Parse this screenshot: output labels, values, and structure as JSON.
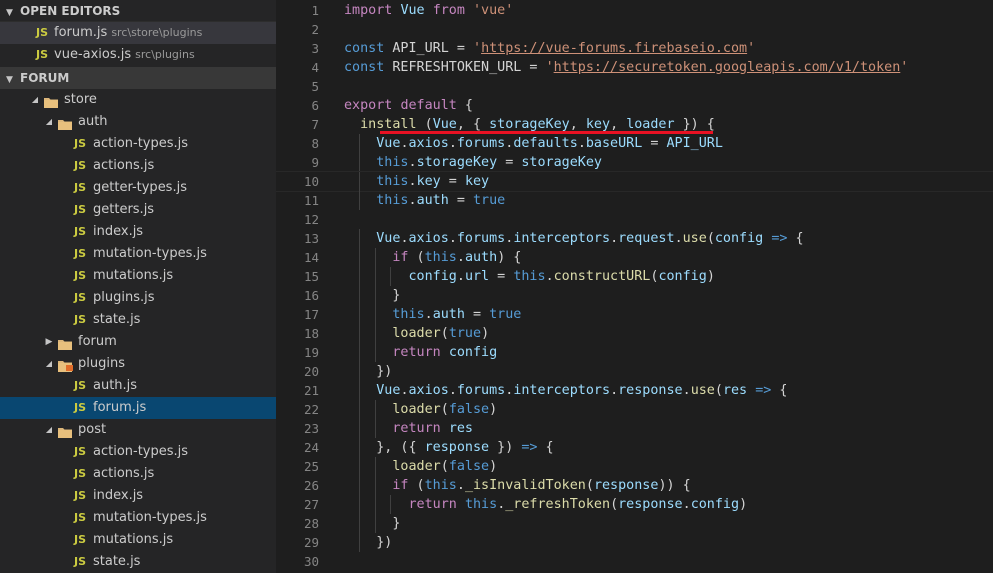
{
  "sidebar": {
    "open_editors_title": "OPEN EDITORS",
    "open_editors": [
      {
        "icon": "JS",
        "name": "forum.js",
        "path": "src\\store\\plugins",
        "active": true
      },
      {
        "icon": "JS",
        "name": "vue-axios.js",
        "path": "src\\plugins",
        "active": false
      }
    ],
    "project_title": "FORUM",
    "tree": [
      {
        "type": "folder",
        "name": "store",
        "depth": 0,
        "expanded": true
      },
      {
        "type": "folder",
        "name": "auth",
        "depth": 1,
        "expanded": true
      },
      {
        "type": "file",
        "name": "action-types.js",
        "depth": 2
      },
      {
        "type": "file",
        "name": "actions.js",
        "depth": 2
      },
      {
        "type": "file",
        "name": "getter-types.js",
        "depth": 2
      },
      {
        "type": "file",
        "name": "getters.js",
        "depth": 2
      },
      {
        "type": "file",
        "name": "index.js",
        "depth": 2
      },
      {
        "type": "file",
        "name": "mutation-types.js",
        "depth": 2
      },
      {
        "type": "file",
        "name": "mutations.js",
        "depth": 2
      },
      {
        "type": "file",
        "name": "plugins.js",
        "depth": 2
      },
      {
        "type": "file",
        "name": "state.js",
        "depth": 2
      },
      {
        "type": "folder",
        "name": "forum",
        "depth": 1,
        "expanded": false
      },
      {
        "type": "folder",
        "name": "plugins",
        "depth": 1,
        "expanded": true,
        "special": true
      },
      {
        "type": "file",
        "name": "auth.js",
        "depth": 2
      },
      {
        "type": "file",
        "name": "forum.js",
        "depth": 2,
        "selected": true
      },
      {
        "type": "folder",
        "name": "post",
        "depth": 1,
        "expanded": true
      },
      {
        "type": "file",
        "name": "action-types.js",
        "depth": 2
      },
      {
        "type": "file",
        "name": "actions.js",
        "depth": 2
      },
      {
        "type": "file",
        "name": "index.js",
        "depth": 2
      },
      {
        "type": "file",
        "name": "mutation-types.js",
        "depth": 2
      },
      {
        "type": "file",
        "name": "mutations.js",
        "depth": 2
      },
      {
        "type": "file",
        "name": "state.js",
        "depth": 2
      }
    ]
  },
  "editor": {
    "lines": [
      [
        [
          "kw2",
          "import"
        ],
        [
          "op",
          " "
        ],
        [
          "var",
          "Vue"
        ],
        [
          "op",
          " "
        ],
        [
          "kw2",
          "from"
        ],
        [
          "op",
          " "
        ],
        [
          "str",
          "'vue'"
        ]
      ],
      [],
      [
        [
          "kw",
          "const"
        ],
        [
          "op",
          " API_URL = "
        ],
        [
          "str",
          "'"
        ],
        [
          "str url",
          "https://vue-forums.firebaseio.com"
        ],
        [
          "str",
          "'"
        ]
      ],
      [
        [
          "kw",
          "const"
        ],
        [
          "op",
          " REFRESHTOKEN_URL = "
        ],
        [
          "str",
          "'"
        ],
        [
          "str url",
          "https://securetoken.googleapis.com/v1/token"
        ],
        [
          "str",
          "'"
        ]
      ],
      [],
      [
        [
          "kw2",
          "export"
        ],
        [
          "op",
          " "
        ],
        [
          "kw2",
          "default"
        ],
        [
          "op",
          " {"
        ]
      ],
      [
        [
          "op",
          "  "
        ],
        [
          "fn",
          "install"
        ],
        [
          "op",
          " ("
        ],
        [
          "var",
          "Vue"
        ],
        [
          "op",
          ", { "
        ],
        [
          "var",
          "storageKey"
        ],
        [
          "op",
          ", "
        ],
        [
          "var",
          "key"
        ],
        [
          "op",
          ", "
        ],
        [
          "var",
          "loader"
        ],
        [
          "op",
          " }) {"
        ]
      ],
      [
        [
          "op",
          "    "
        ],
        [
          "var",
          "Vue"
        ],
        [
          "op",
          "."
        ],
        [
          "var",
          "axios"
        ],
        [
          "op",
          "."
        ],
        [
          "var",
          "forums"
        ],
        [
          "op",
          "."
        ],
        [
          "var",
          "defaults"
        ],
        [
          "op",
          "."
        ],
        [
          "var",
          "baseURL"
        ],
        [
          "op",
          " = "
        ],
        [
          "var",
          "API_URL"
        ]
      ],
      [
        [
          "op",
          "    "
        ],
        [
          "kw",
          "this"
        ],
        [
          "op",
          "."
        ],
        [
          "var",
          "storageKey"
        ],
        [
          "op",
          " = "
        ],
        [
          "var",
          "storageKey"
        ]
      ],
      [
        [
          "op",
          "    "
        ],
        [
          "kw",
          "this"
        ],
        [
          "op",
          "."
        ],
        [
          "var",
          "key"
        ],
        [
          "op",
          " = "
        ],
        [
          "var",
          "key"
        ]
      ],
      [
        [
          "op",
          "    "
        ],
        [
          "kw",
          "this"
        ],
        [
          "op",
          "."
        ],
        [
          "var",
          "auth"
        ],
        [
          "op",
          " = "
        ],
        [
          "kw",
          "true"
        ]
      ],
      [],
      [
        [
          "op",
          "    "
        ],
        [
          "var",
          "Vue"
        ],
        [
          "op",
          "."
        ],
        [
          "var",
          "axios"
        ],
        [
          "op",
          "."
        ],
        [
          "var",
          "forums"
        ],
        [
          "op",
          "."
        ],
        [
          "var",
          "interceptors"
        ],
        [
          "op",
          "."
        ],
        [
          "var",
          "request"
        ],
        [
          "op",
          "."
        ],
        [
          "fn",
          "use"
        ],
        [
          "op",
          "("
        ],
        [
          "var",
          "config"
        ],
        [
          "op",
          " "
        ],
        [
          "kw",
          "=>"
        ],
        [
          "op",
          " {"
        ]
      ],
      [
        [
          "op",
          "      "
        ],
        [
          "kw2",
          "if"
        ],
        [
          "op",
          " ("
        ],
        [
          "kw",
          "this"
        ],
        [
          "op",
          "."
        ],
        [
          "var",
          "auth"
        ],
        [
          "op",
          ") {"
        ]
      ],
      [
        [
          "op",
          "        "
        ],
        [
          "var",
          "config"
        ],
        [
          "op",
          "."
        ],
        [
          "var",
          "url"
        ],
        [
          "op",
          " = "
        ],
        [
          "kw",
          "this"
        ],
        [
          "op",
          "."
        ],
        [
          "fn",
          "constructURL"
        ],
        [
          "op",
          "("
        ],
        [
          "var",
          "config"
        ],
        [
          "op",
          ")"
        ]
      ],
      [
        [
          "op",
          "      }"
        ]
      ],
      [
        [
          "op",
          "      "
        ],
        [
          "kw",
          "this"
        ],
        [
          "op",
          "."
        ],
        [
          "var",
          "auth"
        ],
        [
          "op",
          " = "
        ],
        [
          "kw",
          "true"
        ]
      ],
      [
        [
          "op",
          "      "
        ],
        [
          "fn",
          "loader"
        ],
        [
          "op",
          "("
        ],
        [
          "kw",
          "true"
        ],
        [
          "op",
          ")"
        ]
      ],
      [
        [
          "op",
          "      "
        ],
        [
          "kw2",
          "return"
        ],
        [
          "op",
          " "
        ],
        [
          "var",
          "config"
        ]
      ],
      [
        [
          "op",
          "    })"
        ]
      ],
      [
        [
          "op",
          "    "
        ],
        [
          "var",
          "Vue"
        ],
        [
          "op",
          "."
        ],
        [
          "var",
          "axios"
        ],
        [
          "op",
          "."
        ],
        [
          "var",
          "forums"
        ],
        [
          "op",
          "."
        ],
        [
          "var",
          "interceptors"
        ],
        [
          "op",
          "."
        ],
        [
          "var",
          "response"
        ],
        [
          "op",
          "."
        ],
        [
          "fn",
          "use"
        ],
        [
          "op",
          "("
        ],
        [
          "var",
          "res"
        ],
        [
          "op",
          " "
        ],
        [
          "kw",
          "=>"
        ],
        [
          "op",
          " {"
        ]
      ],
      [
        [
          "op",
          "      "
        ],
        [
          "fn",
          "loader"
        ],
        [
          "op",
          "("
        ],
        [
          "kw",
          "false"
        ],
        [
          "op",
          ")"
        ]
      ],
      [
        [
          "op",
          "      "
        ],
        [
          "kw2",
          "return"
        ],
        [
          "op",
          " "
        ],
        [
          "var",
          "res"
        ]
      ],
      [
        [
          "op",
          "    }, ({ "
        ],
        [
          "var",
          "response"
        ],
        [
          "op",
          " }) "
        ],
        [
          "kw",
          "=>"
        ],
        [
          "op",
          " {"
        ]
      ],
      [
        [
          "op",
          "      "
        ],
        [
          "fn",
          "loader"
        ],
        [
          "op",
          "("
        ],
        [
          "kw",
          "false"
        ],
        [
          "op",
          ")"
        ]
      ],
      [
        [
          "op",
          "      "
        ],
        [
          "kw2",
          "if"
        ],
        [
          "op",
          " ("
        ],
        [
          "kw",
          "this"
        ],
        [
          "op",
          "."
        ],
        [
          "fn",
          "_isInvalidToken"
        ],
        [
          "op",
          "("
        ],
        [
          "var",
          "response"
        ],
        [
          "op",
          ")) {"
        ]
      ],
      [
        [
          "op",
          "        "
        ],
        [
          "kw2",
          "return"
        ],
        [
          "op",
          " "
        ],
        [
          "kw",
          "this"
        ],
        [
          "op",
          "."
        ],
        [
          "fn",
          "_refreshToken"
        ],
        [
          "op",
          "("
        ],
        [
          "var",
          "response"
        ],
        [
          "op",
          "."
        ],
        [
          "var",
          "config"
        ],
        [
          "op",
          ")"
        ]
      ],
      [
        [
          "op",
          "      }"
        ]
      ],
      [
        [
          "op",
          "    })"
        ]
      ],
      [],
      []
    ],
    "current_line": 10,
    "highlight_color": "#e81123"
  }
}
